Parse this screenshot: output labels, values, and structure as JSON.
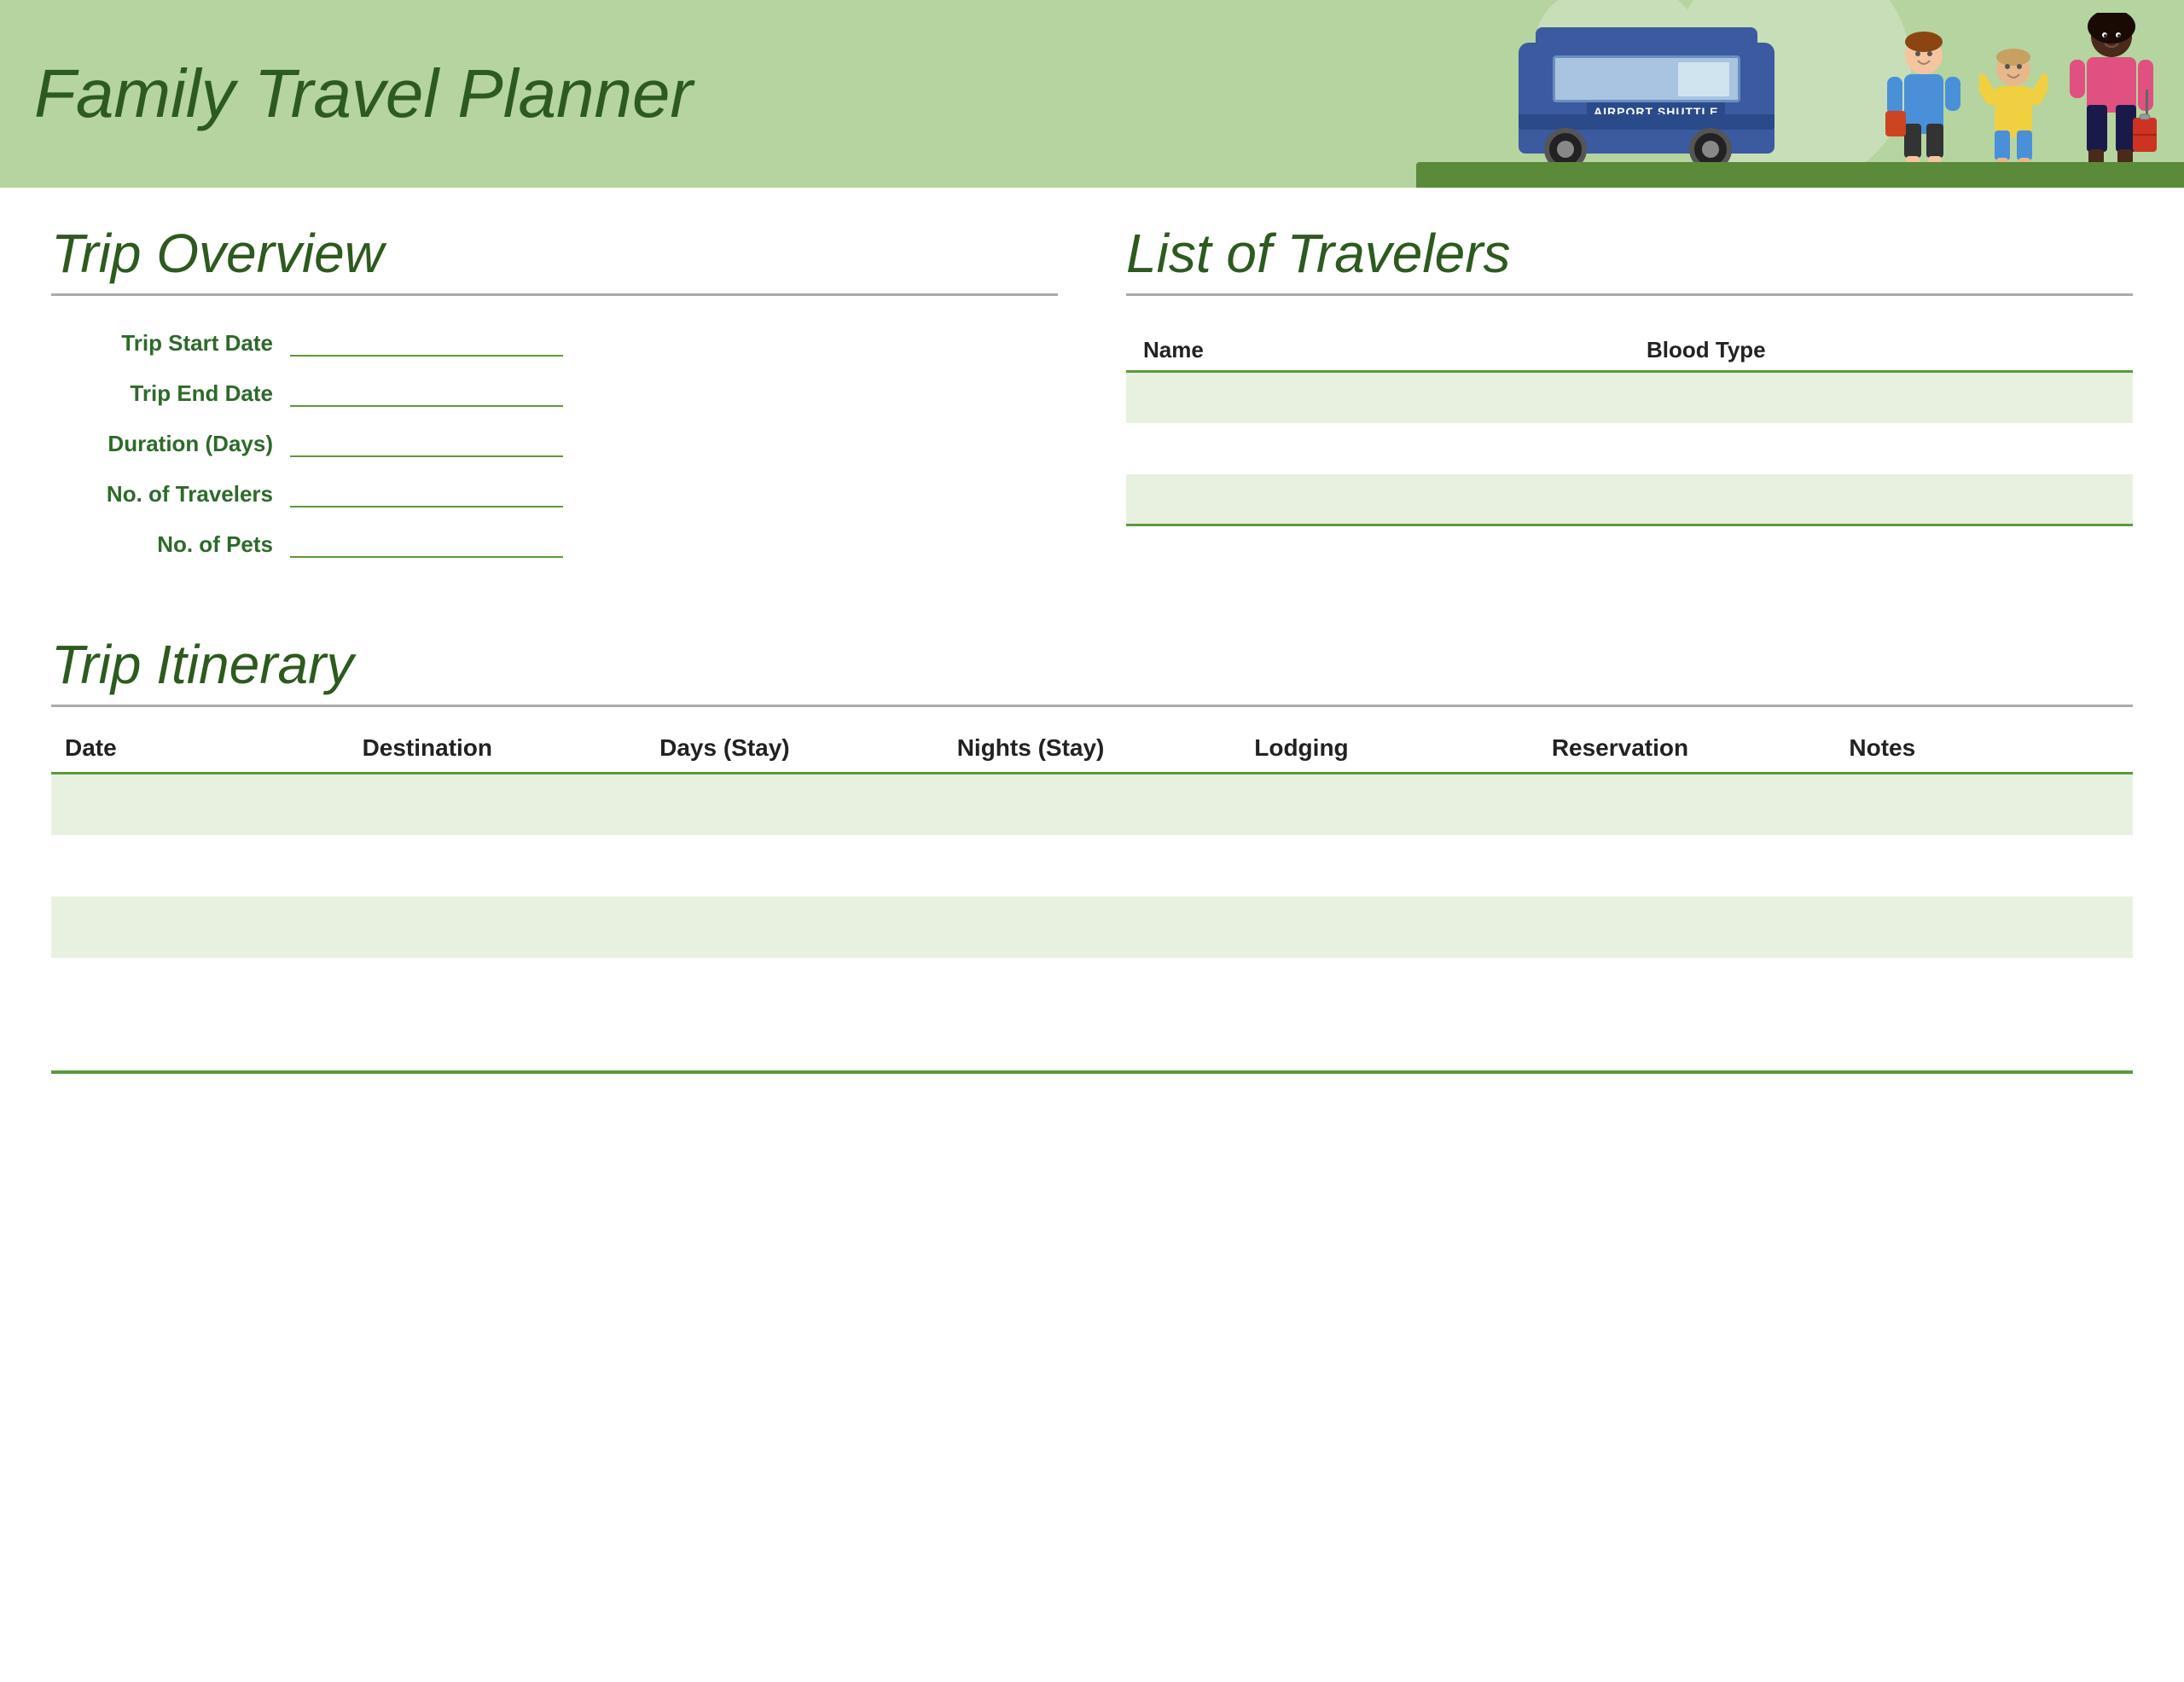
{
  "header": {
    "title": "Family Travel Planner",
    "bus_label": "AIRPORT SHUTTLE"
  },
  "trip_overview": {
    "section_title": "Trip Overview",
    "fields": [
      {
        "label": "Trip Start Date",
        "id": "trip-start-date"
      },
      {
        "label": "Trip End Date",
        "id": "trip-end-date"
      },
      {
        "label": "Duration (Days)",
        "id": "duration-days"
      },
      {
        "label": "No. of Travelers",
        "id": "num-travelers"
      },
      {
        "label": "No. of Pets",
        "id": "num-pets"
      }
    ]
  },
  "list_of_travelers": {
    "section_title": "List of Travelers",
    "columns": [
      "Name",
      "Blood Type"
    ],
    "rows": [
      {
        "name": "",
        "blood_type": ""
      },
      {
        "name": "",
        "blood_type": ""
      },
      {
        "name": "",
        "blood_type": ""
      }
    ]
  },
  "trip_itinerary": {
    "section_title": "Trip Itinerary",
    "columns": [
      "Date",
      "Destination",
      "Days (Stay)",
      "Nights (Stay)",
      "Lodging",
      "Reservation",
      "Notes"
    ],
    "rows": [
      {
        "date": "",
        "destination": "",
        "days_stay": "",
        "nights_stay": "",
        "lodging": "",
        "reservation": "",
        "notes": ""
      },
      {
        "date": "",
        "destination": "",
        "days_stay": "",
        "nights_stay": "",
        "lodging": "",
        "reservation": "",
        "notes": ""
      },
      {
        "date": "",
        "destination": "",
        "days_stay": "",
        "nights_stay": "",
        "lodging": "",
        "reservation": "",
        "notes": ""
      },
      {
        "date": "",
        "destination": "",
        "days_stay": "",
        "nights_stay": "",
        "lodging": "",
        "reservation": "",
        "notes": ""
      }
    ]
  }
}
